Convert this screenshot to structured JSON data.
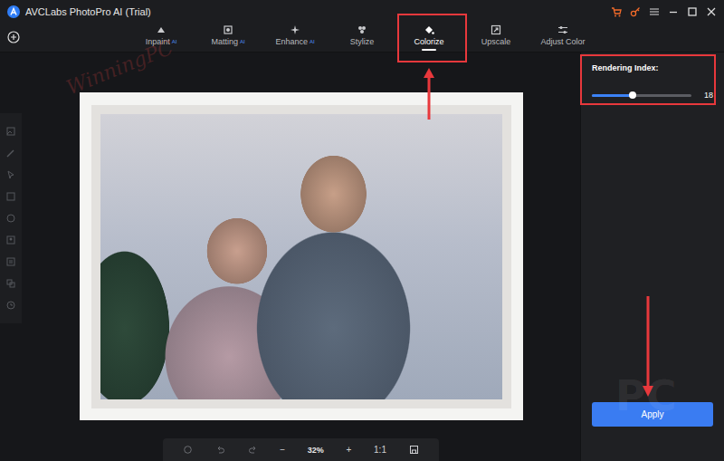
{
  "window": {
    "title": "AVCLabs PhotoPro AI (Trial)"
  },
  "tabs": [
    {
      "label": "Inpaint",
      "badge": "AI",
      "selected": false
    },
    {
      "label": "Matting",
      "badge": "AI",
      "selected": false
    },
    {
      "label": "Enhance",
      "badge": "AI",
      "selected": false
    },
    {
      "label": "Stylize",
      "selected": false
    },
    {
      "label": "Colorize",
      "selected": true
    },
    {
      "label": "Upscale",
      "selected": false
    },
    {
      "label": "Adjust Color",
      "selected": false
    }
  ],
  "panel": {
    "label": "Rendering Index:",
    "slider": {
      "level": 0.41,
      "reading": "18"
    },
    "apply": "Apply"
  },
  "zoom": {
    "minus": "−",
    "value": "32%",
    "plus": "+",
    "actual": "1:1"
  },
  "watermarks": [
    "WinningPC",
    "PC"
  ]
}
